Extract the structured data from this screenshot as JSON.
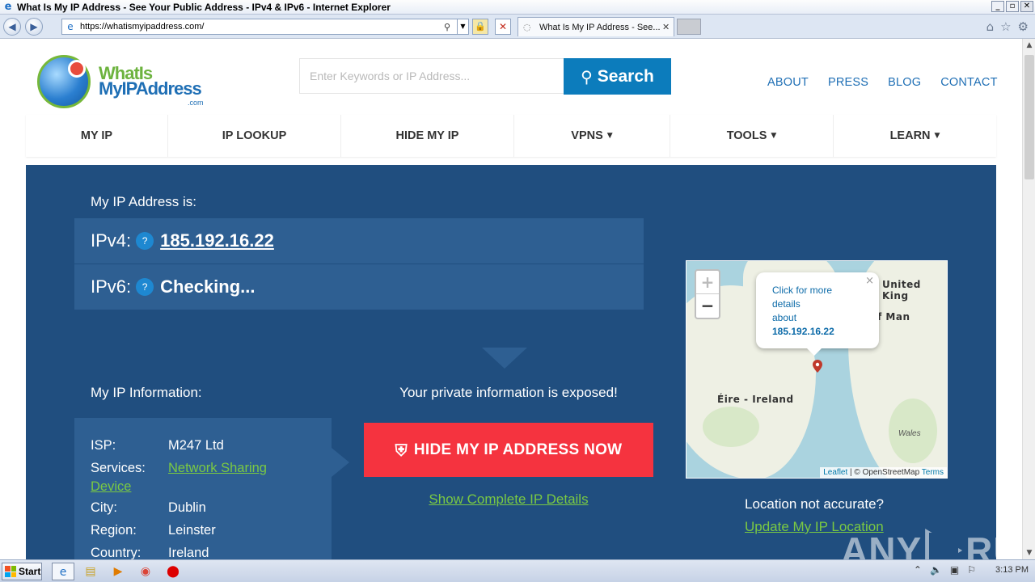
{
  "window": {
    "title": "What Is My IP Address - See Your Public Address - IPv4 & IPv6 - Internet Explorer",
    "controls": [
      "_",
      "▫",
      "✕"
    ]
  },
  "browser": {
    "url": "https://whatismyipaddress.com/",
    "tab_title": "What Is My IP Address - See...",
    "icons": [
      "back-icon",
      "forward-icon",
      "search-icon",
      "lock-icon",
      "stop-icon",
      "home-icon",
      "favorites-icon",
      "tools-gear-icon"
    ]
  },
  "site": {
    "logo": {
      "line1": "WhatIs",
      "line2": "MyIPAddress",
      "line3": ".com"
    },
    "search": {
      "placeholder": "Enter Keywords or IP Address...",
      "button_label": "Search"
    },
    "top_links": [
      "ABOUT",
      "PRESS",
      "BLOG",
      "CONTACT"
    ],
    "nav": [
      {
        "label": "MY IP",
        "caret": ""
      },
      {
        "label": "IP LOOKUP",
        "caret": ""
      },
      {
        "label": "HIDE MY IP",
        "caret": ""
      },
      {
        "label": "VPNS",
        "caret": "▼"
      },
      {
        "label": "TOOLS",
        "caret": "▼"
      },
      {
        "label": "LEARN",
        "caret": "▼"
      }
    ]
  },
  "hero": {
    "my_ip_label": "My IP Address is:",
    "ipv4": {
      "key": "IPv4:",
      "help": "?",
      "value": "185.192.16.22"
    },
    "ipv6": {
      "key": "IPv6:",
      "help": "?",
      "value": "Checking..."
    },
    "info_label": "My IP Information:",
    "info": {
      "isp": {
        "key": "ISP:",
        "value": "M247 Ltd"
      },
      "services": {
        "key": "Services:",
        "value_a": "Network Sharing",
        "value_b": "Device"
      },
      "city": {
        "key": "City:",
        "value": "Dublin"
      },
      "region": {
        "key": "Region:",
        "value": "Leinster"
      },
      "country": {
        "key": "Country:",
        "value": "Ireland"
      }
    },
    "exposed_text": "Your private information is exposed!",
    "hide_button": "HIDE MY IP ADDRESS NOW",
    "show_details": "Show Complete IP Details",
    "map": {
      "zoom_in": "+",
      "zoom_out": "−",
      "popup_line1": "Click for more",
      "popup_line2": "details",
      "popup_line3": "about",
      "popup_ip": "185.192.16.22",
      "popup_close": "×",
      "labels": {
        "uk": "United King",
        "man": "f Man",
        "ireland": "Éire - Ireland",
        "wales": "Wales"
      },
      "attribution": {
        "leaflet": "Leaflet",
        "sep": " | © OpenStreetMap ",
        "terms": "Terms"
      }
    },
    "location_question": "Location not accurate?",
    "location_update": "Update My IP Location"
  },
  "watermark": {
    "left": "ANY",
    "right": "RUN"
  },
  "taskbar": {
    "start": "Start",
    "time": "3:13 PM",
    "apps": [
      "internet-explorer-icon",
      "file-explorer-icon",
      "media-player-icon",
      "chrome-icon",
      "stop-sign-icon"
    ]
  }
}
